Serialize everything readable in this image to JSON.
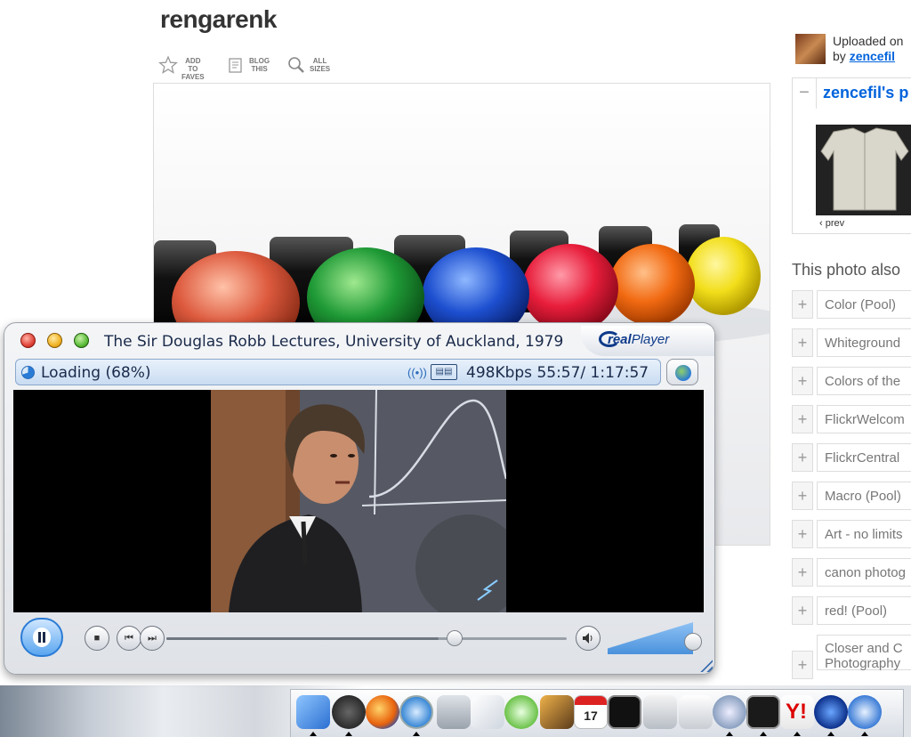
{
  "flickr": {
    "photo_title": "rengarenk",
    "actions": [
      {
        "label": "ADD TO\nFAVES",
        "icon": "star-icon"
      },
      {
        "label": "BLOG\nTHIS",
        "icon": "blog-icon"
      },
      {
        "label": "ALL\nSIZES",
        "icon": "magnifier-icon"
      }
    ],
    "photo_subject": "colored marker caps",
    "uploader": {
      "uploaded_on": "Uploaded on",
      "by_prefix": "by",
      "username": "zencefil"
    },
    "stream": {
      "toggle": "−",
      "title": "zencefil's p",
      "prev_label": "‹ prev"
    },
    "also_in_heading": "This photo also",
    "pools": [
      {
        "label": "Color (Pool)"
      },
      {
        "label": "Whiteground"
      },
      {
        "label": "Colors of the"
      },
      {
        "label": "FlickrWelcom"
      },
      {
        "label": "FlickrCentral"
      },
      {
        "label": "Macro (Pool)"
      },
      {
        "label": "Art - no limits"
      },
      {
        "label": "canon photog"
      },
      {
        "label": "red! (Pool)"
      },
      {
        "label": "Closer and C\nPhotography"
      }
    ],
    "plus_symbol": "+"
  },
  "realplayer": {
    "window_title": "The Sir Douglas Robb Lectures, University of Auckland, 1979",
    "logo_real": "real",
    "logo_player": "Player",
    "status": {
      "loading_text": "Loading (68%)",
      "loading_fraction": 0.68,
      "signal_icon": "((•))",
      "bitrate_time": "498Kbps 55:57/ 1:17:57"
    },
    "playback": {
      "position_fraction": 0.72,
      "buffer_fraction": 0.68,
      "volume_fraction": 1.0
    },
    "controls": {
      "stop_glyph": "■",
      "prev_glyph": "⏮",
      "next_glyph": "⏭",
      "volume_glyph": "🔊"
    }
  },
  "dock": {
    "calendar_day": "17",
    "yahoo_letter": "Y!"
  },
  "colors": {
    "flickr_link": "#0063dc",
    "realplayer_blue": "#2a7bd6",
    "status_bar": "#c9dcf2"
  }
}
